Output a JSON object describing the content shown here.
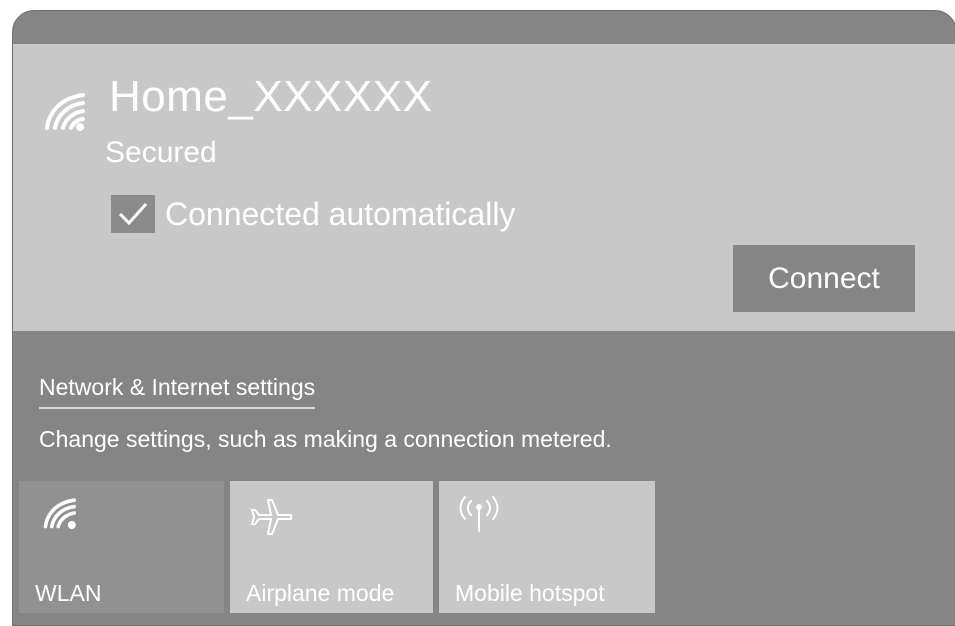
{
  "network": {
    "ssid": "Home_XXXXXX",
    "security": "Secured",
    "auto_connect_label": "Connected automatically",
    "auto_connect_checked": true,
    "connect_label": "Connect"
  },
  "settings": {
    "link_label": "Network & Internet settings",
    "description": "Change settings, such as making a connection metered."
  },
  "quick_actions": [
    {
      "label": "WLAN",
      "icon": "wifi-icon",
      "active": true
    },
    {
      "label": "Airplane mode",
      "icon": "airplane-icon",
      "active": false
    },
    {
      "label": "Mobile hotspot",
      "icon": "hotspot-icon",
      "active": false
    }
  ],
  "colors": {
    "card_bg": "#c8c8c8",
    "panel_bg": "#858585",
    "active_tile": "#919191",
    "text": "#ffffff"
  }
}
